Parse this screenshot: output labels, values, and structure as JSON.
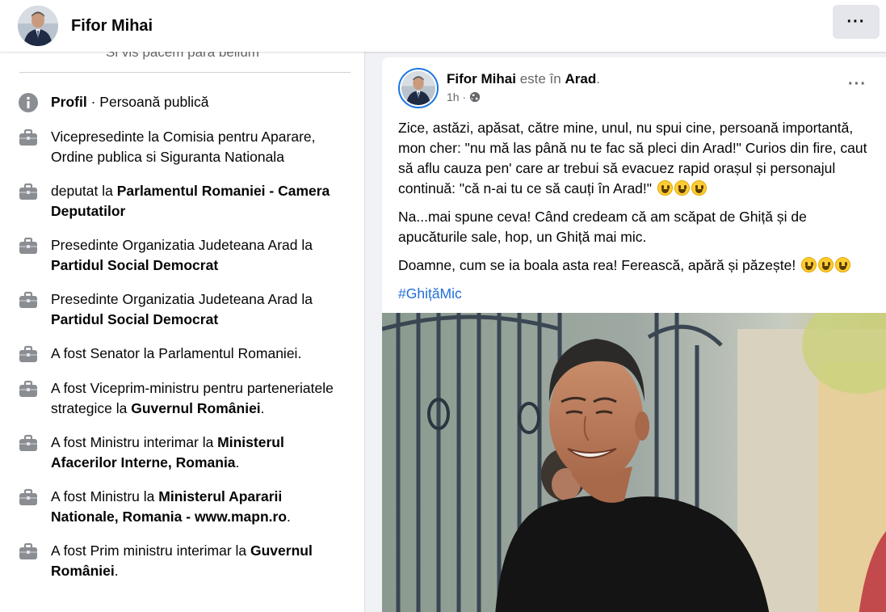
{
  "header": {
    "name": "Fifor Mihai",
    "more_label": "···"
  },
  "intro": {
    "motto": "Si vis pacem para bellum",
    "items": [
      {
        "icon": "info-icon",
        "parts": [
          {
            "t": "Profil",
            "b": true
          },
          {
            "t": " · Persoană publică",
            "b": false
          }
        ]
      },
      {
        "icon": "briefcase-icon",
        "parts": [
          {
            "t": "Vicepresedinte la Comisia pentru Aparare, Ordine publica si Siguranta Nationala",
            "b": false
          }
        ]
      },
      {
        "icon": "briefcase-icon",
        "parts": [
          {
            "t": "deputat la ",
            "b": false
          },
          {
            "t": "Parlamentul Romaniei - Camera Deputatilor",
            "b": true
          }
        ]
      },
      {
        "icon": "briefcase-icon",
        "parts": [
          {
            "t": "Presedinte Organizatia Judeteana Arad la ",
            "b": false
          },
          {
            "t": "Partidul Social Democrat",
            "b": true
          }
        ]
      },
      {
        "icon": "briefcase-icon",
        "parts": [
          {
            "t": "Presedinte Organizatia Judeteana Arad la ",
            "b": false
          },
          {
            "t": "Partidul Social Democrat",
            "b": true
          }
        ]
      },
      {
        "icon": "briefcase-icon",
        "parts": [
          {
            "t": "A fost Senator la Parlamentul Romaniei.",
            "b": false
          }
        ]
      },
      {
        "icon": "briefcase-icon",
        "parts": [
          {
            "t": "A fost Viceprim-ministru pentru parteneriatele strategice la ",
            "b": false
          },
          {
            "t": "Guvernul României",
            "b": true
          },
          {
            "t": ".",
            "b": false
          }
        ]
      },
      {
        "icon": "briefcase-icon",
        "parts": [
          {
            "t": "A fost Ministru interimar la ",
            "b": false
          },
          {
            "t": "Ministerul Afacerilor Interne, Romania",
            "b": true
          },
          {
            "t": ".",
            "b": false
          }
        ]
      },
      {
        "icon": "briefcase-icon",
        "parts": [
          {
            "t": "A fost Ministru la ",
            "b": false
          },
          {
            "t": "Ministerul Apararii Nationale, Romania - www.mapn.ro",
            "b": true
          },
          {
            "t": ".",
            "b": false
          }
        ]
      },
      {
        "icon": "briefcase-icon",
        "parts": [
          {
            "t": "A fost Prim ministru interimar la ",
            "b": false
          },
          {
            "t": "Guvernul României",
            "b": true
          },
          {
            "t": ".",
            "b": false
          }
        ]
      }
    ]
  },
  "post": {
    "author": "Fifor Mihai",
    "is_in": "este în",
    "place": "Arad",
    "place_suffix": ".",
    "time": "1h",
    "more_label": "···",
    "paragraph1": "Zice, astăzi, apăsat, către mine, unul, nu spui cine, persoană importantă, mon cher: \"nu mă las până nu te fac să pleci din Arad!\" Curios din fire, caut să aflu cauza pen' care ar trebui să evacuez rapid orașul și personajul continuă: \"că n-ai tu ce să cauți în Arad!\"",
    "paragraph2": "Na...mai spune ceva! Când credeam că am scăpat de Ghiță și de apucăturile sale, hop, un Ghiță mai mic.",
    "paragraph3": "Doamne, cum se ia boala asta rea! Ferească, apără și păzește!",
    "hashtag": "#GhițăMic",
    "emoji_name": "grinning-face-emoji"
  }
}
